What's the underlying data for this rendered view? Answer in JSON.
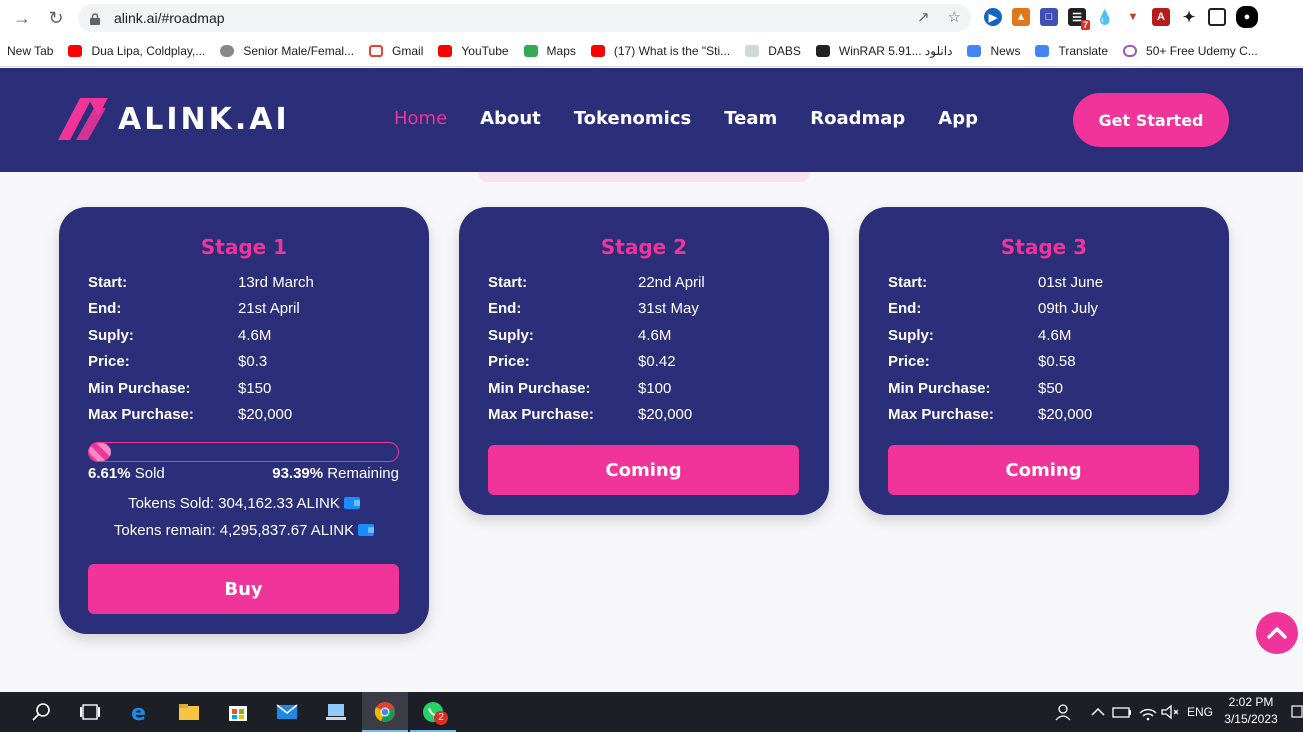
{
  "browser": {
    "url": "alink.ai/#roadmap",
    "bookmarks": [
      {
        "label": "New Tab",
        "color": ""
      },
      {
        "label": "Dua Lipa, Coldplay,...",
        "color": "#ff0000"
      },
      {
        "label": "Senior Male/Femal...",
        "color": "#888888"
      },
      {
        "label": "Gmail",
        "color": "#ea4335"
      },
      {
        "label": "YouTube",
        "color": "#ff0000"
      },
      {
        "label": "Maps",
        "color": "#34a853"
      },
      {
        "label": "(17) What is the \"Sti...",
        "color": "#ff0000"
      },
      {
        "label": "DABS",
        "color": "#9aa0a6"
      },
      {
        "label": "WinRAR 5.91... دانلود",
        "color": "#222222"
      },
      {
        "label": "News",
        "color": "#4285f4"
      },
      {
        "label": "Translate",
        "color": "#4285f4"
      },
      {
        "label": "50+ Free Udemy C...",
        "color": "#9b59b6"
      }
    ],
    "extension_badge": "7"
  },
  "site": {
    "logo_text": "ALINK.AI",
    "nav": [
      "Home",
      "About",
      "Tokenomics",
      "Team",
      "Roadmap",
      "App"
    ],
    "cta": "Get Started",
    "brand_pink": "#f0349a",
    "brand_navy": "#2b2e78"
  },
  "stages": [
    {
      "title": "Stage 1",
      "rows": [
        {
          "k": "Start:",
          "v": "13rd March"
        },
        {
          "k": "End:",
          "v": "21st April"
        },
        {
          "k": "Suply:",
          "v": "4.6M"
        },
        {
          "k": "Price:",
          "v": "$0.3"
        },
        {
          "k": "Min Purchase:",
          "v": "$150"
        },
        {
          "k": "Max Purchase:",
          "v": "$20,000"
        }
      ],
      "sold_pct": "6.61%",
      "sold_label": "Sold",
      "remaining_pct": "93.39%",
      "remaining_label": "Remaining",
      "progress": 0.0661,
      "tokens_sold": "Tokens Sold: 304,162.33 ALINK",
      "tokens_remain": "Tokens remain: 4,295,837.67 ALINK",
      "button": "Buy"
    },
    {
      "title": "Stage 2",
      "rows": [
        {
          "k": "Start:",
          "v": "22nd April"
        },
        {
          "k": "End:",
          "v": "31st May"
        },
        {
          "k": "Suply:",
          "v": "4.6M"
        },
        {
          "k": "Price:",
          "v": "$0.42"
        },
        {
          "k": "Min Purchase:",
          "v": "$100"
        },
        {
          "k": "Max Purchase:",
          "v": "$20,000"
        }
      ],
      "button": "Coming"
    },
    {
      "title": "Stage 3",
      "rows": [
        {
          "k": "Start:",
          "v": "01st June"
        },
        {
          "k": "End:",
          "v": "09th July"
        },
        {
          "k": "Suply:",
          "v": "4.6M"
        },
        {
          "k": "Price:",
          "v": "$0.58"
        },
        {
          "k": "Min Purchase:",
          "v": "$50"
        },
        {
          "k": "Max Purchase:",
          "v": "$20,000"
        }
      ],
      "button": "Coming"
    }
  ],
  "taskbar": {
    "lang": "ENG",
    "time": "2:02 PM",
    "date": "3/15/2023",
    "whatsapp_badge": "2"
  }
}
